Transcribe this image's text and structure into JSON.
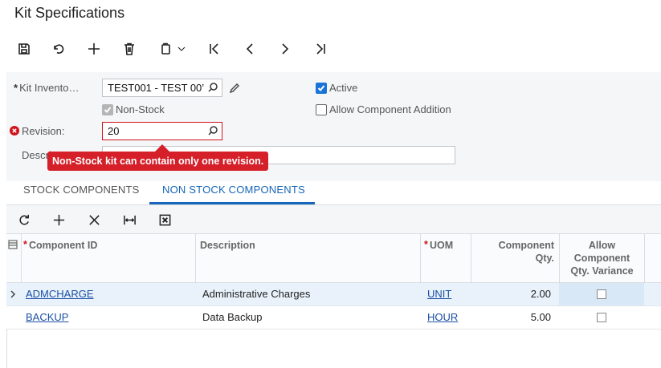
{
  "page": {
    "title": "Kit Specifications"
  },
  "toolbar": {
    "icons": [
      "save-icon",
      "undo-icon",
      "add-icon",
      "delete-icon",
      "copy-paste-icon",
      "first-record-icon",
      "previous-record-icon",
      "next-record-icon",
      "last-record-icon"
    ]
  },
  "form": {
    "kit_inventory_label": "Kit Invento…",
    "kit_inventory_value": "TEST001 - TEST 00’",
    "non_stock_label": "Non-Stock",
    "non_stock_checked": true,
    "active_label": "Active",
    "active_checked": true,
    "allow_component_label": "Allow Component Addition",
    "allow_component_checked": false,
    "revision_label": "Revision:",
    "revision_value": "20",
    "description_label": "Descri",
    "description_label_tail": "n:",
    "description_value": ""
  },
  "error": {
    "message": "Non-Stock kit can contain only one revision."
  },
  "tabs": [
    {
      "label": "STOCK COMPONENTS",
      "active": false
    },
    {
      "label": "NON STOCK COMPONENTS",
      "active": true
    }
  ],
  "grid": {
    "toolbar_icons": [
      "refresh-icon",
      "add-row-icon",
      "delete-row-icon",
      "fit-columns-icon",
      "export-excel-icon"
    ],
    "columns": {
      "component_id": "Component ID",
      "description": "Description",
      "uom": "UOM",
      "component_qty_line1": "Component",
      "component_qty_line2": "Qty.",
      "allow_variance_line1": "Allow",
      "allow_variance_line2": "Component",
      "allow_variance_line3": "Qty. Variance"
    },
    "rows": [
      {
        "component_id": "ADMCHARGE",
        "description": "Administrative Charges",
        "uom": "UNIT",
        "qty": "2.00",
        "allow_variance": false,
        "selected": true
      },
      {
        "component_id": "BACKUP",
        "description": "Data Backup",
        "uom": "HOUR",
        "qty": "5.00",
        "allow_variance": false,
        "selected": false
      }
    ]
  },
  "colors": {
    "accent": "#1565b8",
    "error": "#d51f29",
    "link": "#1b4fa6"
  }
}
